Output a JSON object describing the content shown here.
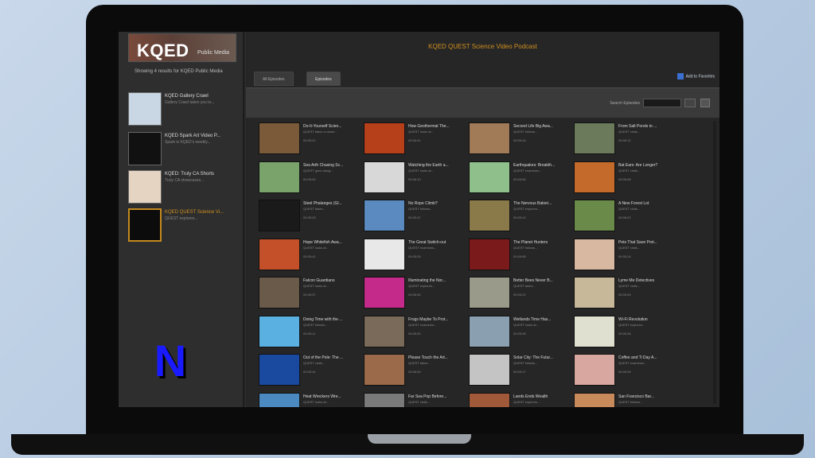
{
  "sidebar": {
    "logo_text": "KQED",
    "logo_sub": "Public Media",
    "caption": "Showing 4 results for KQED Public Media",
    "items": [
      {
        "title": "KQED Gallery Crawl",
        "desc": "Gallery Crawl takes you to...",
        "thumb": "#c9d6e3",
        "selected": false
      },
      {
        "title": "KQED Spark Art Video P...",
        "desc": "Spark is KQED's weekly...",
        "thumb": "#111111",
        "selected": false
      },
      {
        "title": "KQED: Truly CA Shorts",
        "desc": "Truly CA showcases...",
        "thumb": "#e6d4c2",
        "selected": false
      },
      {
        "title": "KQED QUEST Science Vi...",
        "desc": "QUEST explores...",
        "thumb": "#0c0c0c",
        "selected": true
      }
    ]
  },
  "main": {
    "title": "KQED QUEST Science Video Podcast",
    "tabs": [
      {
        "label": "All Episodes",
        "active": false
      },
      {
        "label": "Episodes",
        "active": true
      }
    ],
    "subscribe_label": "Add to Favorites",
    "search_label": "Search Episodes"
  },
  "colors": {
    "accent": "#d0901f",
    "background": "#262626"
  },
  "episodes": [
    {
      "title": "Do-It-Yourself Scien...",
      "desc": "QUEST takes a closer...",
      "dur": "00:05:21",
      "thumb": "#7b5a3a"
    },
    {
      "title": "How Geothermal The...",
      "desc": "QUEST looks at...",
      "dur": "00:06:01",
      "thumb": "#b5401a"
    },
    {
      "title": "Second Life Big Awa...",
      "desc": "QUEST follows...",
      "dur": "00:05:44",
      "thumb": "#a17a58"
    },
    {
      "title": "From Salt Ponds to ...",
      "desc": "QUEST visits...",
      "dur": "00:05:12",
      "thumb": "#6a7a5a"
    },
    {
      "title": "Sea Arth Chasing Sc...",
      "desc": "QUEST goes along...",
      "dur": "00:05:30",
      "thumb": "#7aa36b"
    },
    {
      "title": "Watching the Earth a...",
      "desc": "QUEST looks at...",
      "dur": "00:06:10",
      "thumb": "#d8d8d8"
    },
    {
      "title": "Earthquakes: Breakth...",
      "desc": "QUEST examines...",
      "dur": "00:05:55",
      "thumb": "#8fbf8a"
    },
    {
      "title": "Bat Ears: Are Longer?",
      "desc": "QUEST visits...",
      "dur": "00:05:08",
      "thumb": "#c46a2a"
    },
    {
      "title": "Steel Phalanges (Gl...",
      "desc": "QUEST takes...",
      "dur": "00:05:33",
      "thumb": "#1a1a1a"
    },
    {
      "title": "No Rope Climb?",
      "desc": "QUEST follows...",
      "dur": "00:05:47",
      "thumb": "#5a8ac0"
    },
    {
      "title": "The Nervous Bakeri...",
      "desc": "QUEST explores...",
      "dur": "00:05:19",
      "thumb": "#8a7a4a"
    },
    {
      "title": "A New Forest Lot",
      "desc": "QUEST visits...",
      "dur": "00:06:02",
      "thumb": "#6a8a4a"
    },
    {
      "title": "Hope Whitefish Awa...",
      "desc": "QUEST looks at...",
      "dur": "00:05:41",
      "thumb": "#c4502a"
    },
    {
      "title": "The Great Switch-out",
      "desc": "QUEST examines...",
      "dur": "00:05:26",
      "thumb": "#e8e8e8"
    },
    {
      "title": "The Planet Hunters",
      "desc": "QUEST follows...",
      "dur": "00:05:58",
      "thumb": "#7a1a1a"
    },
    {
      "title": "Pets That Save Prot...",
      "desc": "QUEST visits...",
      "dur": "00:05:14",
      "thumb": "#d8b8a0"
    },
    {
      "title": "Falcon Guardians",
      "desc": "QUEST looks at...",
      "dur": "00:05:37",
      "thumb": "#6a5a4a"
    },
    {
      "title": "Illuminating the Nor...",
      "desc": "QUEST explores...",
      "dur": "00:06:05",
      "thumb": "#c42a8a"
    },
    {
      "title": "Better Bees Never B...",
      "desc": "QUEST takes...",
      "dur": "00:05:22",
      "thumb": "#9a9a8a"
    },
    {
      "title": "Lyme Me Detectives",
      "desc": "QUEST visits...",
      "dur": "00:05:49",
      "thumb": "#c8b89a"
    },
    {
      "title": "Doing Time with the ...",
      "desc": "QUEST follows...",
      "dur": "00:05:11",
      "thumb": "#5ab0e0"
    },
    {
      "title": "Frogs Maybe To Prot...",
      "desc": "QUEST examines...",
      "dur": "00:05:53",
      "thumb": "#7a6a5a"
    },
    {
      "title": "Wetlands Time Has...",
      "desc": "QUEST looks at...",
      "dur": "00:05:28",
      "thumb": "#8aa0b0"
    },
    {
      "title": "Wi-Fi Revolution",
      "desc": "QUEST explores...",
      "dur": "00:05:36",
      "thumb": "#e0e0d0"
    },
    {
      "title": "Out of the Pole: The ...",
      "desc": "QUEST visits...",
      "dur": "00:05:44",
      "thumb": "#1a4aa0"
    },
    {
      "title": "Please Touch the Art...",
      "desc": "QUEST takes...",
      "dur": "00:06:00",
      "thumb": "#9a6a4a"
    },
    {
      "title": "Solar City: The Futur...",
      "desc": "QUEST follows...",
      "dur": "00:05:17",
      "thumb": "#c4c4c4"
    },
    {
      "title": "Coffee and Ti Day A...",
      "desc": "QUEST examines...",
      "dur": "00:05:39",
      "thumb": "#d8a8a0"
    },
    {
      "title": "Heat Wreckers Wre...",
      "desc": "QUEST looks at...",
      "dur": "00:05:24",
      "thumb": "#4a8ac0"
    },
    {
      "title": "Far Sea Pop Before...",
      "desc": "QUEST visits...",
      "dur": "00:05:51",
      "thumb": "#7a7a7a"
    },
    {
      "title": "Lands Ends Wealth",
      "desc": "QUEST explores...",
      "dur": "00:05:32",
      "thumb": "#a05a3a"
    },
    {
      "title": "San Francisco Bar...",
      "desc": "QUEST follows...",
      "dur": "00:05:45",
      "thumb": "#c88a5a"
    }
  ]
}
